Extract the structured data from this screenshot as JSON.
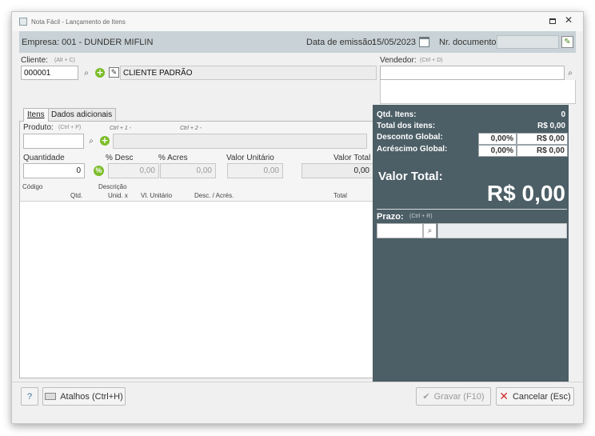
{
  "window": {
    "title": "Nota Fácil - Lançamento de Itens"
  },
  "header": {
    "empresa_text": "Empresa: 001 - DUNDER MIFLIN",
    "data_emissao_label": "Data de emissão:",
    "data_emissao_value": "15/05/2023",
    "nr_documento_label": "Nr. documento:",
    "nr_documento_value": ""
  },
  "cliente": {
    "label": "Cliente:",
    "hint": "(Alt + C)",
    "code": "000001",
    "name": "CLIENTE PADRÃO"
  },
  "vendedor": {
    "label": "Vendedor:",
    "hint": "(Ctrl + D)",
    "value": ""
  },
  "tabs": [
    {
      "label": "Itens",
      "active": true
    },
    {
      "label": "Dados adicionais",
      "active": false
    }
  ],
  "produto": {
    "label": "Produto:",
    "hint": "(Ctrl + P)",
    "hint_ctrl1": "Ctrl + 1 -",
    "hint_ctrl2": "Ctrl + 2 -",
    "value": ""
  },
  "fields": {
    "quantidade_label": "Quantidade",
    "quantidade_value": "0",
    "desc_label": "% Desc",
    "desc_value": "0,00",
    "acres_label": "% Acres",
    "acres_value": "0,00",
    "valor_unitario_label": "Valor Unitário",
    "valor_unitario_value": "0,00",
    "valor_total_label": "Valor Total",
    "valor_total_value": "0,00"
  },
  "grid_headers": {
    "codigo": "Código",
    "descricao": "Descrição",
    "qtd": "Qtd.",
    "unid": "Unid. x",
    "vl_unitario": "Vl. Unitário",
    "desc_acres": "Desc. / Acrés.",
    "total": "Total"
  },
  "summary": {
    "qtd_itens_label": "Qtd. Itens:",
    "qtd_itens_value": "0",
    "total_itens_label": "Total dos itens:",
    "total_itens_value": "R$ 0,00",
    "desconto_label": "Desconto Global:",
    "desconto_pct": "0,00%",
    "desconto_value": "R$ 0,00",
    "acrescimo_label": "Acréscimo Global:",
    "acrescimo_pct": "0,00%",
    "acrescimo_value": "R$ 0,00",
    "valor_total_label": "Valor Total:",
    "valor_total_value": "R$ 0,00",
    "prazo_label": "Prazo:",
    "prazo_hint": "(Ctrl + R)"
  },
  "footer": {
    "help_label": "?",
    "atalhos_label": "Atalhos (Ctrl+H)",
    "gravar_label": "Gravar (F10)",
    "cancelar_label": "Cancelar (Esc)"
  },
  "colors": {
    "header_bar": "#c9d2d6",
    "dark_panel": "#4c5e66",
    "accent_green": "#7cbd2a",
    "cancel_red": "#d32f2f"
  },
  "icons": {
    "app": "nota-icon",
    "restore": "restore-icon",
    "close": "close-icon",
    "calendar": "calendar-icon",
    "edit": "edit-icon",
    "search": "search-icon",
    "add": "plus-circle-icon",
    "percent": "percent-icon",
    "keyboard": "keyboard-icon",
    "check": "check-icon",
    "cancel": "x-icon"
  }
}
